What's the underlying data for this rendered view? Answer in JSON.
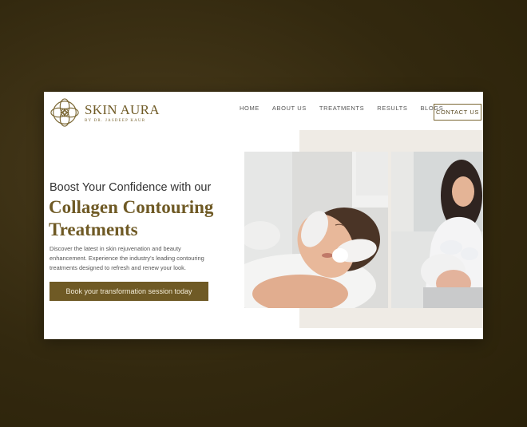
{
  "brand": {
    "name": "SKIN AURA",
    "tagline": "BY DR. JASDEEP KAUR",
    "logo_icon": "lotus-knot-icon"
  },
  "nav": {
    "items": [
      "HOME",
      "ABOUT US",
      "TREATMENTS",
      "RESULTS",
      "BLOGS"
    ],
    "contact_label": "CONTACT US"
  },
  "hero": {
    "pre_title": "Boost Your Confidence with our",
    "title_line1": "Collagen Contouring",
    "title_line2": "Treatments",
    "description": "Discover the latest in skin rejuvenation and beauty enhancement. Experience the industry's leading contouring treatments designed to refresh and renew your look.",
    "cta_label": "Book your transformation session today"
  },
  "images": {
    "photo1": "facial-cleansing-treatment-photo",
    "photo2": "doctor-skin-treatment-photo"
  },
  "colors": {
    "brand_gold": "#6f5a25",
    "page_background": "#3a2f14",
    "panel_background": "#efebe5"
  }
}
